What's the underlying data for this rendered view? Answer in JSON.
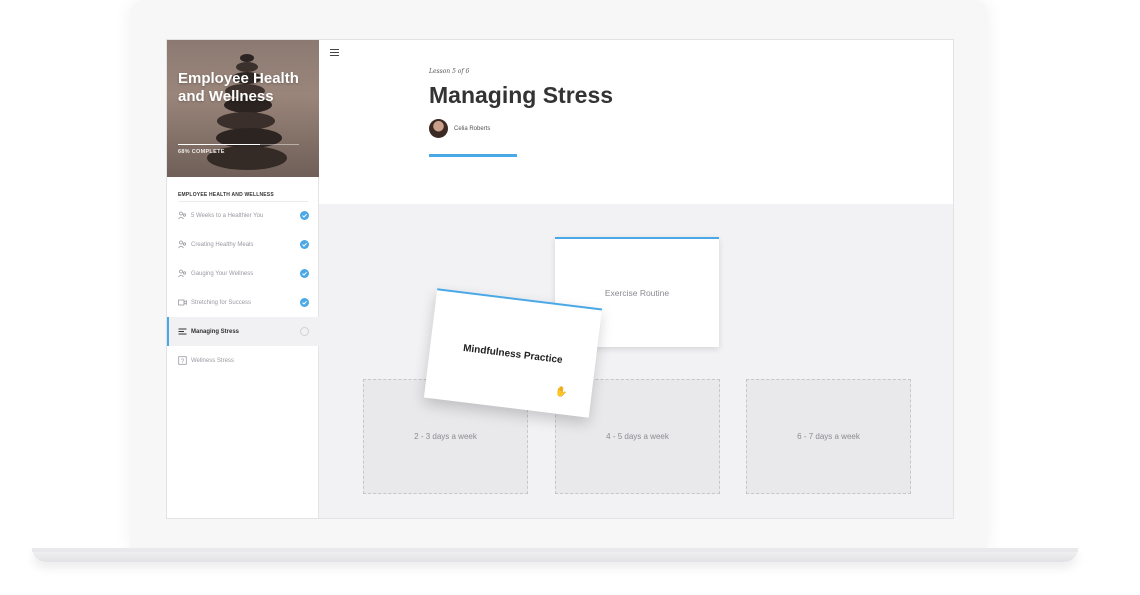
{
  "course": {
    "title": "Employee Health and Wellness",
    "progress_label": "68% COMPLETE",
    "progress": 0.68
  },
  "sidebar": {
    "section_title": "EMPLOYEE HEALTH AND WELLNESS",
    "items": [
      {
        "label": "5 Weeks to a Healthier You",
        "icon": "people-icon",
        "status": "complete"
      },
      {
        "label": "Creating Healthy Meals",
        "icon": "people-icon",
        "status": "complete"
      },
      {
        "label": "Gauging Your Wellness",
        "icon": "people-icon",
        "status": "complete"
      },
      {
        "label": "Stretching for Success",
        "icon": "video-icon",
        "status": "complete"
      },
      {
        "label": "Managing Stress",
        "icon": "text-lines-icon",
        "status": "in-progress",
        "active": true
      },
      {
        "label": "Wellness Stress",
        "icon": "quiz-icon",
        "status": "not-started"
      }
    ]
  },
  "lesson": {
    "counter": "Lesson 5 of 6",
    "title": "Managing Stress",
    "author": "Celia Roberts"
  },
  "activity": {
    "cards": {
      "back": "Exercise Routine",
      "front": "Mindfulness Practice"
    },
    "drop_zones": [
      "2 - 3 days a week",
      "4 - 5 days a week",
      "6 - 7 days a week"
    ]
  },
  "colors": {
    "accent": "#4aa8e6"
  }
}
